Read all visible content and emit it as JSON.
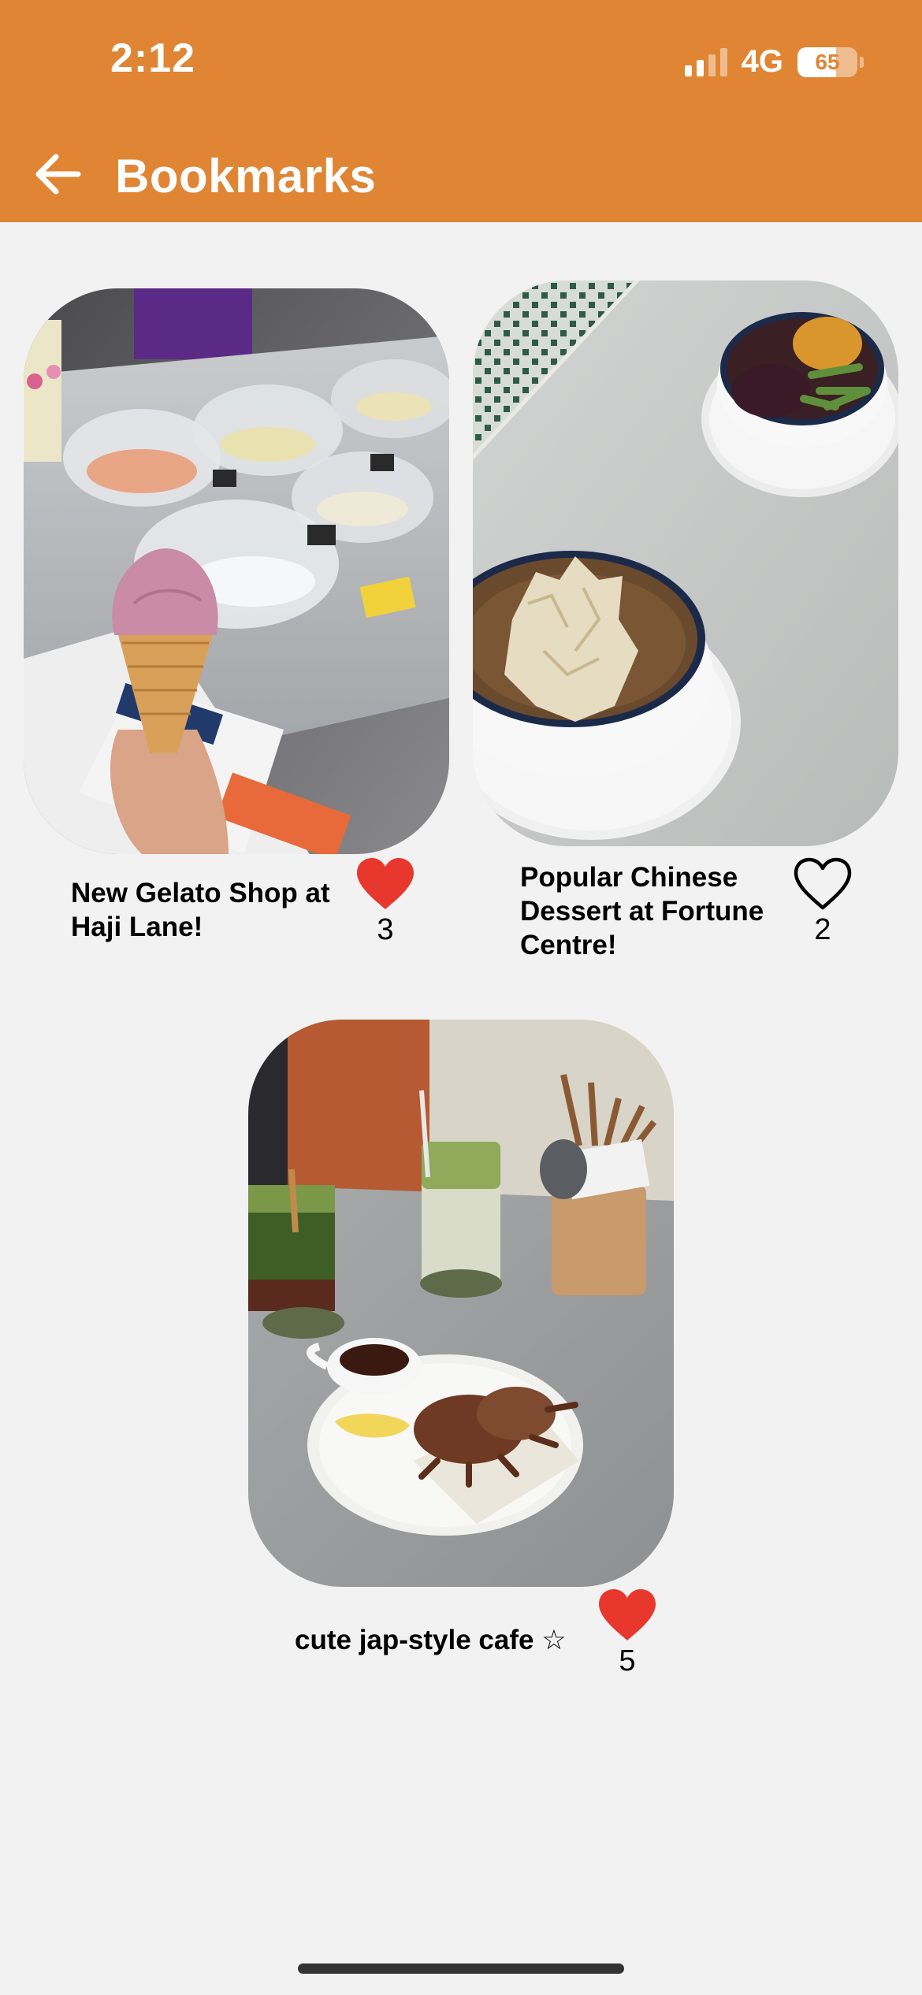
{
  "status_bar": {
    "time": "2:12",
    "network": "4G",
    "battery_level": "65",
    "battery_fraction": 0.65,
    "signal_bars_filled": 2,
    "signal_bars_total": 4
  },
  "header": {
    "title": "Bookmarks",
    "back_icon": "arrow-left-icon",
    "background_color": "#e08533"
  },
  "bookmarks": [
    {
      "title": "New Gelato Shop at\nHaji Lane!",
      "likes": "3",
      "liked": true,
      "image": "gelato-cone-photo"
    },
    {
      "title": "Popular Chinese\nDessert at Fortune\nCentre!",
      "likes": "2",
      "liked": false,
      "image": "chinese-dessert-bowls-photo"
    },
    {
      "title": "cute jap-style cafe ☆",
      "likes": "5",
      "liked": true,
      "image": "matcha-cafe-photo"
    }
  ],
  "colors": {
    "heart_liked": "#e8372c",
    "background": "#f2f2f2"
  }
}
